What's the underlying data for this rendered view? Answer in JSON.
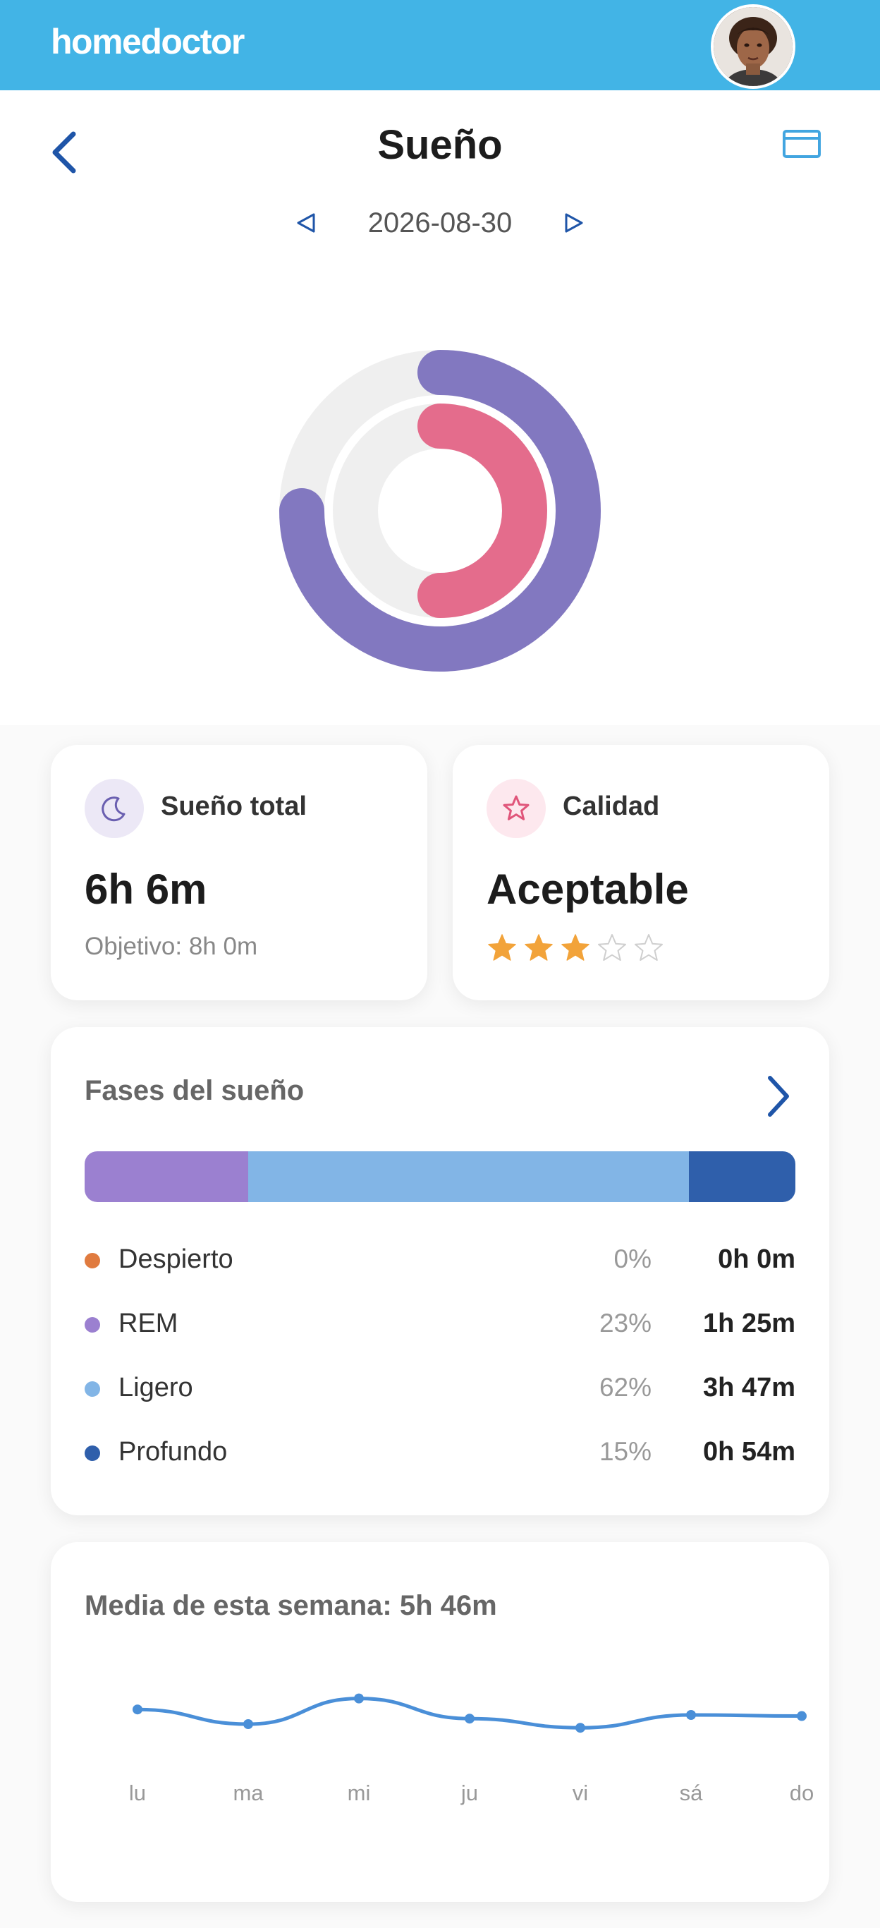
{
  "app": {
    "logo_text": "homedoctor",
    "avatar_icon": "user-avatar"
  },
  "header": {
    "title": "Sueño",
    "back_icon": "chevron-left-icon",
    "calendar_icon": "calendar-icon"
  },
  "date_nav": {
    "date": "2026-08-30",
    "prev_icon": "triangle-left-icon",
    "next_icon": "triangle-right-icon"
  },
  "rings": {
    "outer_fraction": 0.75,
    "inner_fraction": 0.5,
    "outer_color": "#8278c0",
    "inner_color": "#e46c8c",
    "track_color": "#efefef"
  },
  "total_sleep": {
    "label": "Sueño total",
    "value": "6h 6m",
    "goal": "Objetivo: 8h 0m",
    "icon": "moon-icon"
  },
  "quality": {
    "label": "Calidad",
    "value": "Aceptable",
    "rating": 3,
    "max_rating": 5,
    "icon": "star-icon",
    "star_color": "#f2a33a"
  },
  "phases": {
    "title": "Fases del sueño",
    "more_icon": "chevron-right-icon",
    "items": [
      {
        "name": "Despierto",
        "pct": "0%",
        "duration": "0h 0m",
        "share": 0,
        "color": "#e07b3f"
      },
      {
        "name": "REM",
        "pct": "23%",
        "duration": "1h 25m",
        "share": 23,
        "color": "#9b80d0"
      },
      {
        "name": "Ligero",
        "pct": "62%",
        "duration": "3h 47m",
        "share": 62,
        "color": "#82b5e6"
      },
      {
        "name": "Profundo",
        "pct": "15%",
        "duration": "0h 54m",
        "share": 15,
        "color": "#2f5fab"
      }
    ]
  },
  "week": {
    "title": "Media de esta semana: 5h 46m",
    "days": [
      "lu",
      "ma",
      "mi",
      "ju",
      "vi",
      "sá",
      "do"
    ]
  },
  "chart_data": {
    "type": "line",
    "categories": [
      "lu",
      "ma",
      "mi",
      "ju",
      "vi",
      "sá",
      "do"
    ],
    "values": [
      5.9,
      5.5,
      6.2,
      5.65,
      5.4,
      5.75,
      5.72
    ],
    "title": "Media de esta semana: 5h 46m",
    "xlabel": "",
    "ylabel": "",
    "ylim": [
      4.5,
      7.0
    ],
    "grid": false,
    "color": "#4a8fd8"
  }
}
